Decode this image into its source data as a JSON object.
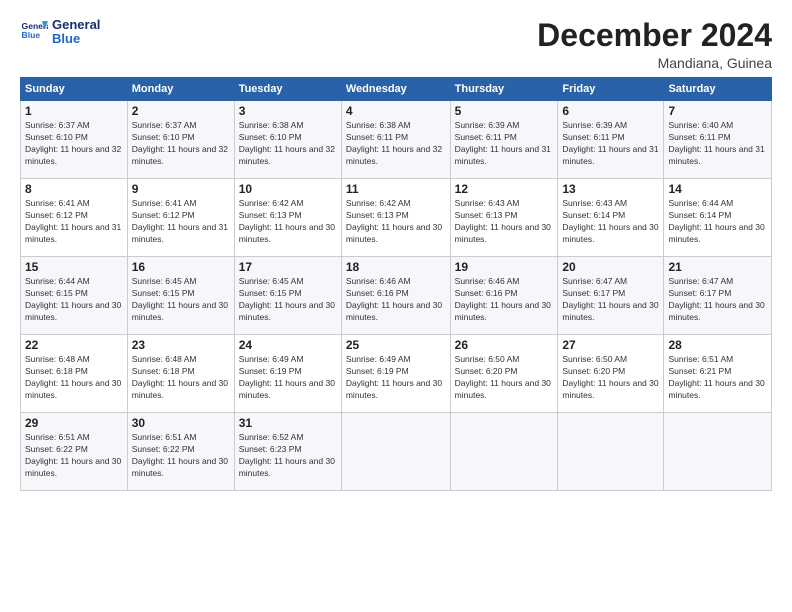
{
  "logo": {
    "line1": "General",
    "line2": "Blue"
  },
  "title": "December 2024",
  "subtitle": "Mandiana, Guinea",
  "days_of_week": [
    "Sunday",
    "Monday",
    "Tuesday",
    "Wednesday",
    "Thursday",
    "Friday",
    "Saturday"
  ],
  "weeks": [
    [
      {
        "day": 1,
        "sunrise": "6:37 AM",
        "sunset": "6:10 PM",
        "daylight": "11 hours and 32 minutes."
      },
      {
        "day": 2,
        "sunrise": "6:37 AM",
        "sunset": "6:10 PM",
        "daylight": "11 hours and 32 minutes."
      },
      {
        "day": 3,
        "sunrise": "6:38 AM",
        "sunset": "6:10 PM",
        "daylight": "11 hours and 32 minutes."
      },
      {
        "day": 4,
        "sunrise": "6:38 AM",
        "sunset": "6:11 PM",
        "daylight": "11 hours and 32 minutes."
      },
      {
        "day": 5,
        "sunrise": "6:39 AM",
        "sunset": "6:11 PM",
        "daylight": "11 hours and 31 minutes."
      },
      {
        "day": 6,
        "sunrise": "6:39 AM",
        "sunset": "6:11 PM",
        "daylight": "11 hours and 31 minutes."
      },
      {
        "day": 7,
        "sunrise": "6:40 AM",
        "sunset": "6:11 PM",
        "daylight": "11 hours and 31 minutes."
      }
    ],
    [
      {
        "day": 8,
        "sunrise": "6:41 AM",
        "sunset": "6:12 PM",
        "daylight": "11 hours and 31 minutes."
      },
      {
        "day": 9,
        "sunrise": "6:41 AM",
        "sunset": "6:12 PM",
        "daylight": "11 hours and 31 minutes."
      },
      {
        "day": 10,
        "sunrise": "6:42 AM",
        "sunset": "6:13 PM",
        "daylight": "11 hours and 30 minutes."
      },
      {
        "day": 11,
        "sunrise": "6:42 AM",
        "sunset": "6:13 PM",
        "daylight": "11 hours and 30 minutes."
      },
      {
        "day": 12,
        "sunrise": "6:43 AM",
        "sunset": "6:13 PM",
        "daylight": "11 hours and 30 minutes."
      },
      {
        "day": 13,
        "sunrise": "6:43 AM",
        "sunset": "6:14 PM",
        "daylight": "11 hours and 30 minutes."
      },
      {
        "day": 14,
        "sunrise": "6:44 AM",
        "sunset": "6:14 PM",
        "daylight": "11 hours and 30 minutes."
      }
    ],
    [
      {
        "day": 15,
        "sunrise": "6:44 AM",
        "sunset": "6:15 PM",
        "daylight": "11 hours and 30 minutes."
      },
      {
        "day": 16,
        "sunrise": "6:45 AM",
        "sunset": "6:15 PM",
        "daylight": "11 hours and 30 minutes."
      },
      {
        "day": 17,
        "sunrise": "6:45 AM",
        "sunset": "6:15 PM",
        "daylight": "11 hours and 30 minutes."
      },
      {
        "day": 18,
        "sunrise": "6:46 AM",
        "sunset": "6:16 PM",
        "daylight": "11 hours and 30 minutes."
      },
      {
        "day": 19,
        "sunrise": "6:46 AM",
        "sunset": "6:16 PM",
        "daylight": "11 hours and 30 minutes."
      },
      {
        "day": 20,
        "sunrise": "6:47 AM",
        "sunset": "6:17 PM",
        "daylight": "11 hours and 30 minutes."
      },
      {
        "day": 21,
        "sunrise": "6:47 AM",
        "sunset": "6:17 PM",
        "daylight": "11 hours and 30 minutes."
      }
    ],
    [
      {
        "day": 22,
        "sunrise": "6:48 AM",
        "sunset": "6:18 PM",
        "daylight": "11 hours and 30 minutes."
      },
      {
        "day": 23,
        "sunrise": "6:48 AM",
        "sunset": "6:18 PM",
        "daylight": "11 hours and 30 minutes."
      },
      {
        "day": 24,
        "sunrise": "6:49 AM",
        "sunset": "6:19 PM",
        "daylight": "11 hours and 30 minutes."
      },
      {
        "day": 25,
        "sunrise": "6:49 AM",
        "sunset": "6:19 PM",
        "daylight": "11 hours and 30 minutes."
      },
      {
        "day": 26,
        "sunrise": "6:50 AM",
        "sunset": "6:20 PM",
        "daylight": "11 hours and 30 minutes."
      },
      {
        "day": 27,
        "sunrise": "6:50 AM",
        "sunset": "6:20 PM",
        "daylight": "11 hours and 30 minutes."
      },
      {
        "day": 28,
        "sunrise": "6:51 AM",
        "sunset": "6:21 PM",
        "daylight": "11 hours and 30 minutes."
      }
    ],
    [
      {
        "day": 29,
        "sunrise": "6:51 AM",
        "sunset": "6:22 PM",
        "daylight": "11 hours and 30 minutes."
      },
      {
        "day": 30,
        "sunrise": "6:51 AM",
        "sunset": "6:22 PM",
        "daylight": "11 hours and 30 minutes."
      },
      {
        "day": 31,
        "sunrise": "6:52 AM",
        "sunset": "6:23 PM",
        "daylight": "11 hours and 30 minutes."
      },
      null,
      null,
      null,
      null
    ]
  ]
}
